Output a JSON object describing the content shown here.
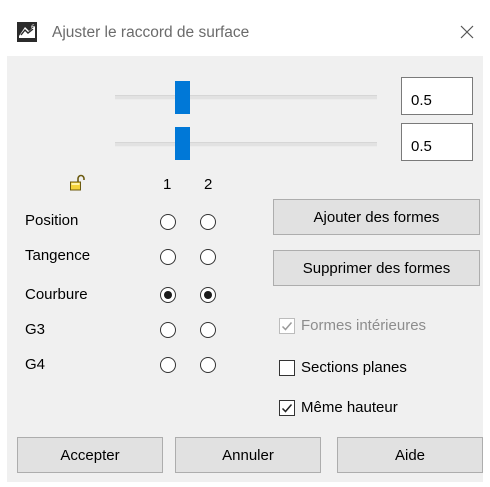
{
  "window": {
    "title": "Ajuster le raccord de surface",
    "close_icon": "close-icon",
    "app_icon": "rhino-app-icon"
  },
  "sliders": [
    {
      "value": "0.5",
      "fraction": 0.5
    },
    {
      "value": "0.5",
      "fraction": 0.5
    }
  ],
  "lock_icon": "unlocked-padlock-icon",
  "continuity": {
    "columns": [
      "1",
      "2"
    ],
    "rows": [
      {
        "label": "Position",
        "selected": [
          false,
          false
        ]
      },
      {
        "label": "Tangence",
        "selected": [
          false,
          false
        ]
      },
      {
        "label": "Courbure",
        "selected": [
          true,
          true
        ]
      },
      {
        "label": "G3",
        "selected": [
          false,
          false
        ]
      },
      {
        "label": "G4",
        "selected": [
          false,
          false
        ]
      }
    ]
  },
  "side_buttons": {
    "add_shapes": "Ajouter des formes",
    "remove_shapes": "Supprimer des formes"
  },
  "options": {
    "interior_shapes": {
      "label": "Formes intérieures",
      "checked": true,
      "enabled": false
    },
    "planar_sections": {
      "label": "Sections planes",
      "checked": false,
      "enabled": true
    },
    "same_height": {
      "label": "Même hauteur",
      "checked": true,
      "enabled": true
    }
  },
  "footer": {
    "accept": "Accepter",
    "cancel": "Annuler",
    "help": "Aide"
  },
  "colors": {
    "slider_thumb": "#0078d7",
    "dialog_background": "#f0f0f0",
    "button_background": "#e1e1e1"
  }
}
